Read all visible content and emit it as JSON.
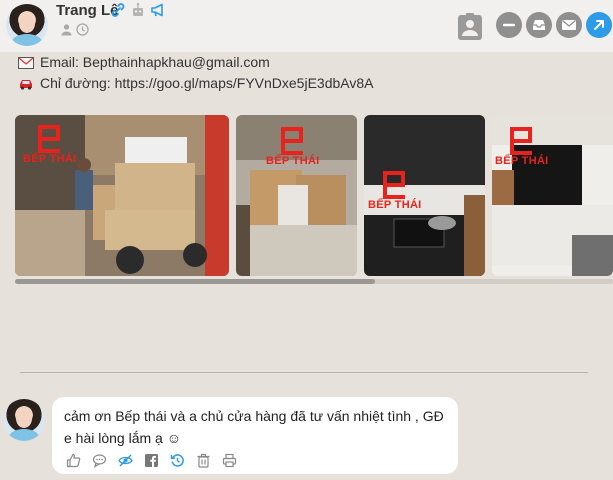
{
  "header": {
    "user_name": "Trang Lê",
    "name_icons": [
      "link-icon",
      "robot-icon",
      "megaphone-icon"
    ],
    "sub_icons": [
      "person-icon",
      "clock-icon"
    ],
    "actions": [
      "contact-card-icon",
      "minimize-icon",
      "inbox-icon",
      "mail-icon",
      "share-icon"
    ]
  },
  "info": {
    "email": "Email: Bepthainhapkhau@gmail.com",
    "directions": "Chỉ đường: https://goo.gl/maps/FYVnDxe5jE3dbAv8A"
  },
  "gallery": {
    "brand_text": "BẾP THÁI",
    "photo_count": 4
  },
  "comment": {
    "text": "cảm ơn Bếp thái và a chủ cửa hàng đã tư vấn nhiệt tình , GĐ e hài lòng lắm ạ ☺",
    "actions": [
      "like-icon",
      "reply-icon",
      "hide-icon",
      "facebook-icon",
      "history-icon",
      "delete-icon",
      "print-icon"
    ]
  },
  "colors": {
    "background": "#e7e1dc",
    "header": "#f2f0ee",
    "accent_blue": "#2d9be8",
    "brand_red": "#e8231d",
    "button_gray": "#8f8f8f"
  }
}
